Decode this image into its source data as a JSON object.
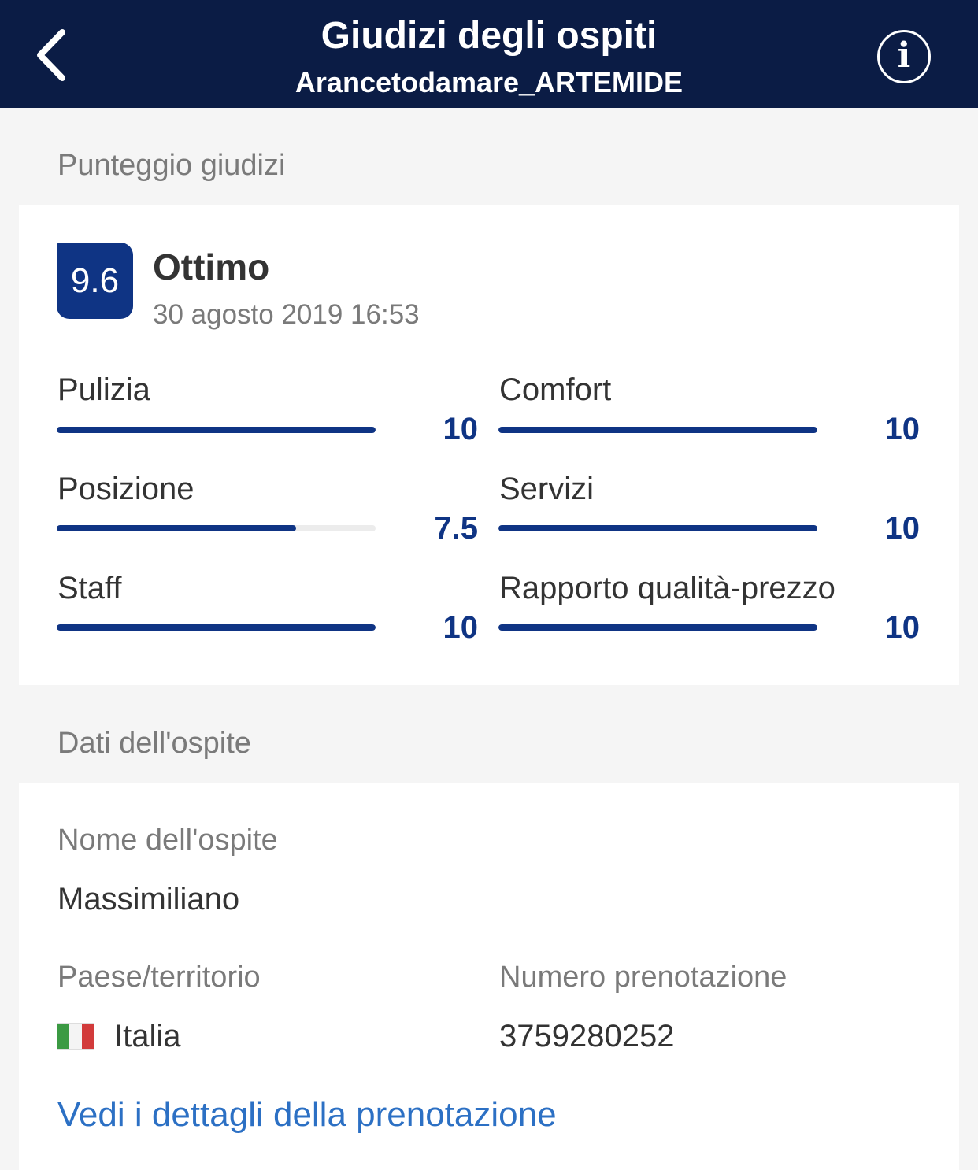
{
  "header": {
    "title": "Giudizi degli ospiti",
    "subtitle": "Arancetodamare_ARTEMIDE",
    "back_icon": "chevron-left-icon",
    "info_icon": "info-icon",
    "info_glyph": "i"
  },
  "ratings": {
    "section_title": "Punteggio giudizi",
    "overall_score": "9.6",
    "overall_word": "Ottimo",
    "date": "30 agosto 2019 16:53",
    "max_score": 10,
    "categories": [
      {
        "label": "Pulizia",
        "value": "10",
        "score": 10
      },
      {
        "label": "Comfort",
        "value": "10",
        "score": 10
      },
      {
        "label": "Posizione",
        "value": "7.5",
        "score": 7.5
      },
      {
        "label": "Servizi",
        "value": "10",
        "score": 10
      },
      {
        "label": "Staff",
        "value": "10",
        "score": 10
      },
      {
        "label": "Rapporto qualità-prezzo",
        "value": "10",
        "score": 10
      }
    ]
  },
  "guest": {
    "section_title": "Dati dell'ospite",
    "name_label": "Nome dell'ospite",
    "name_value": "Massimiliano",
    "country_label": "Paese/territorio",
    "country_value": "Italia",
    "country_flag_icon": "italy-flag-icon",
    "booking_label": "Numero prenotazione",
    "booking_value": "3759280252",
    "details_link": "Vedi i dettagli della prenotazione"
  },
  "colors": {
    "header_bg": "#0b1c45",
    "accent": "#0f3484",
    "link": "#2c70c4"
  }
}
